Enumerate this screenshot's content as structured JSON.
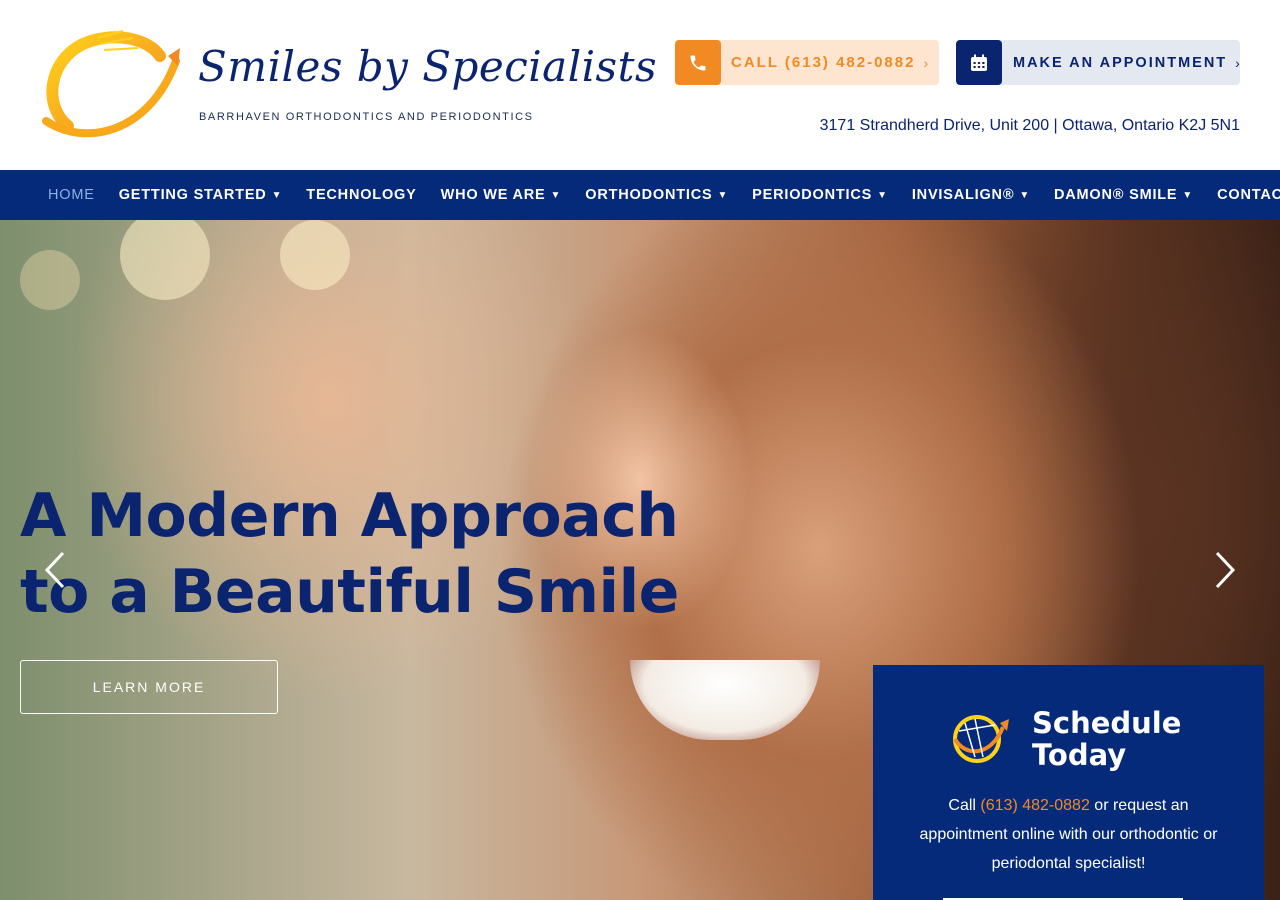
{
  "brand": {
    "name": "Smiles by Specialists",
    "tagline": "BARRHAVEN ORTHODONTICS AND PERIODONTICS",
    "logo_icon": "sun-swoosh-logo",
    "colors": {
      "navy": "#052a7a",
      "orange": "#f28a23",
      "light_orange": "#fde5d0",
      "light_gray": "#e4e8f0"
    }
  },
  "header": {
    "call_label": "CALL (613) 482-0882",
    "call_icon": "phone-icon",
    "appointment_label": "MAKE AN APPOINTMENT",
    "appointment_icon": "calendar-icon",
    "chevron": "›",
    "address": "3171 Strandherd Drive, Unit 200 | Ottawa, Ontario K2J 5N1"
  },
  "nav": {
    "items": [
      {
        "label": "HOME",
        "dropdown": false,
        "active": true
      },
      {
        "label": "GETTING STARTED",
        "dropdown": true
      },
      {
        "label": "TECHNOLOGY",
        "dropdown": false
      },
      {
        "label": "WHO WE ARE",
        "dropdown": true
      },
      {
        "label": "ORTHODONTICS",
        "dropdown": true
      },
      {
        "label": "PERIODONTICS",
        "dropdown": true
      },
      {
        "label": "INVISALIGN®",
        "dropdown": true
      },
      {
        "label": "DAMON® SMILE",
        "dropdown": true
      },
      {
        "label": "CONTACT",
        "dropdown": true
      }
    ],
    "caret": "⌄"
  },
  "hero": {
    "headline_line1": "A Modern Approach",
    "headline_line2": "to a Beautiful Smile",
    "cta_label": "LEARN MORE",
    "prev_icon": "chevron-left-icon",
    "next_icon": "chevron-right-icon"
  },
  "schedule": {
    "title_line1": "Schedule",
    "title_line2": "Today",
    "text_before": "Call ",
    "phone": "(613) 482-0882",
    "text_after": " or request an appointment online with our orthodontic or periodontal specialist!"
  }
}
